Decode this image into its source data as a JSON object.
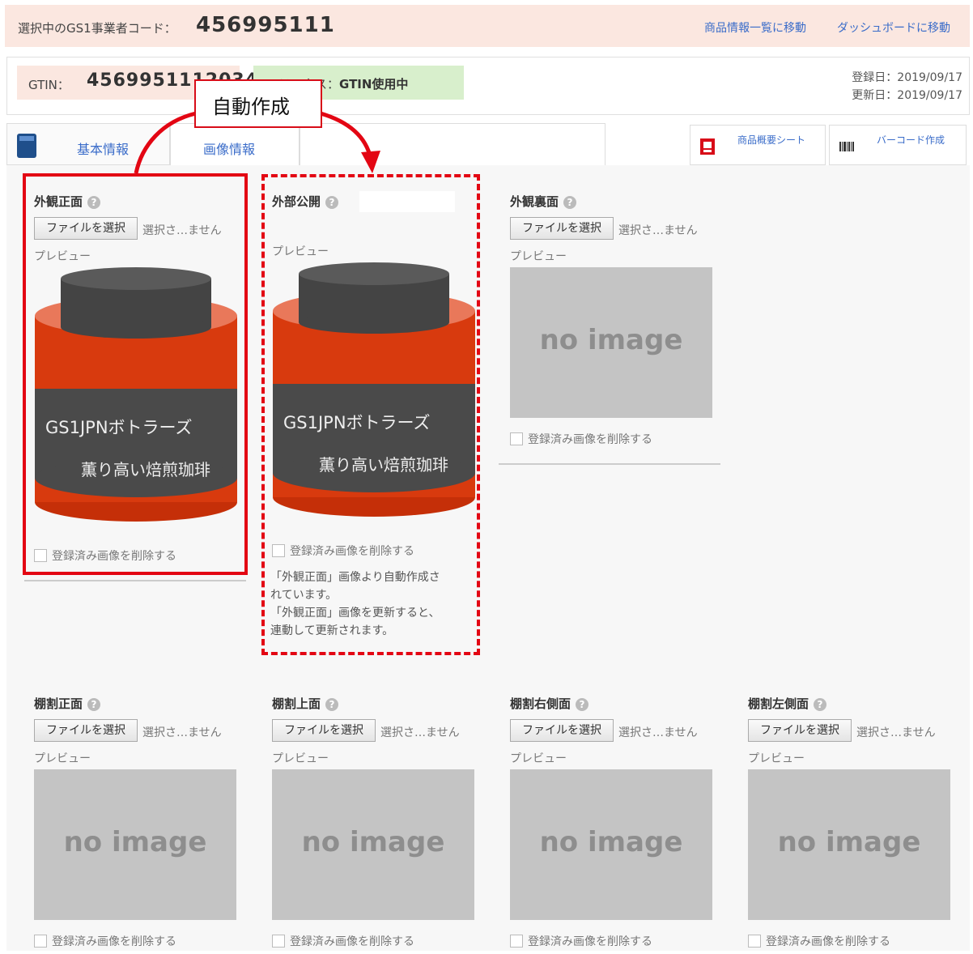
{
  "header": {
    "selected_label": "選択中のGS1事業者コード：",
    "selected_code": "456995111",
    "link_product_list": "商品情報一覧に移動",
    "link_dashboard": "ダッシュボードに移動"
  },
  "info": {
    "gtin_label": "GTIN：",
    "gtin_value": "4569951112034",
    "status_label": "ステータス：",
    "status_value": "GTIN使用中",
    "registered": "登録日：2019/09/17",
    "updated": "更新日：2019/09/17"
  },
  "callout": {
    "text": "自動作成"
  },
  "tabs": {
    "basic": "基本情報",
    "image": "画像情報",
    "product_sheet": "商品概要シート",
    "barcode": "バーコード作成"
  },
  "common": {
    "choose_file": "ファイルを選択",
    "no_file": "選択さ…ません",
    "preview": "プレビュー",
    "no_image": "no image",
    "delete_registered": "登録済み画像を削除する",
    "help": "?"
  },
  "product_image": {
    "brand": "GS1JPNボトラーズ",
    "product": "薫り高い焙煎珈琲"
  },
  "slots": {
    "front": "外観正面",
    "public": "外部公開",
    "back": "外観裏面",
    "shelf_front": "棚割正面",
    "shelf_top": "棚割上面",
    "shelf_right": "棚割右側面",
    "shelf_left": "棚割左側面"
  },
  "public_note": [
    "「外観正面」画像より自動作成さ",
    "れています。",
    "「外観正面」画像を更新すると、",
    "連動して更新されます。"
  ],
  "colors": {
    "accent_red": "#e30613",
    "link_blue": "#3a6cc9",
    "header_bg": "#fbe7e0",
    "status_bg": "#d8efcc",
    "jar_red": "#d83a0e",
    "jar_lid": "#555555",
    "no_image_bg": "#c4c4c4"
  },
  "icons": {
    "help": "question-circle-icon",
    "basic_tab": "document-icon",
    "product_sheet": "document-red-icon",
    "barcode": "barcode-icon"
  }
}
